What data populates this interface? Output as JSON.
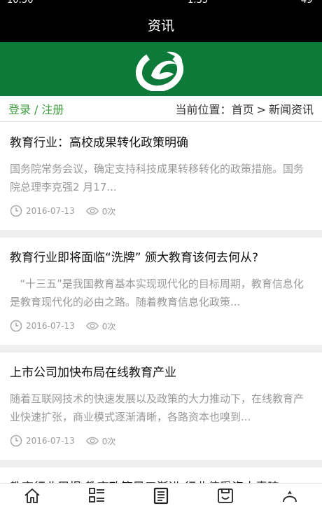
{
  "status_bar": {
    "time_fragment": "10:50",
    "mid_fragment": "1:35",
    "right_fragment": "49"
  },
  "header": {
    "title": "资讯"
  },
  "breadcrumb_bar": {
    "login": "登录",
    "separator": "/",
    "register": "注册",
    "position_label": "当前位置：",
    "home": "首页",
    "arrow": ">",
    "current": "新闻资讯"
  },
  "articles": [
    {
      "title": "教育行业：高校成果转化政策明确",
      "summary": "国务院常务会议，确定支持科技成果转移转化的政策措施。国务院总理李克强2  月17...",
      "date": "2016-07-13",
      "views": "0次"
    },
    {
      "title": "教育行业即将面临“洗牌” 颁大教育该何去何从?",
      "summary": "   “十三五”是我国教育基本实现现代化的目标周期，教育信息化是教育现代化的必由之路。随着教育信息化政策...",
      "date": "2016-07-13",
      "views": "0次"
    },
    {
      "title": "上市公司加快布局在线教育产业",
      "summary": "随着互联网技术的快速发展以及政策的大力推动下，在线教育产业快速扩张，商业模式逐渐清晰，各路资本也嗅到...",
      "date": "2016-07-13",
      "views": "0次"
    },
    {
      "title": "教育行业周报:教育政策风口渐进 行业倍受资本青睐",
      "summary": "",
      "date": "",
      "views": ""
    }
  ],
  "tabs": [
    {
      "icon": "home-icon"
    },
    {
      "icon": "category-list-icon"
    },
    {
      "icon": "news-document-icon"
    },
    {
      "icon": "contact-card-icon"
    },
    {
      "icon": "more-icon"
    }
  ],
  "colors": {
    "brand_green": "#0e7a3a",
    "link_green": "#3e9b3e",
    "muted_text": "#999999"
  }
}
